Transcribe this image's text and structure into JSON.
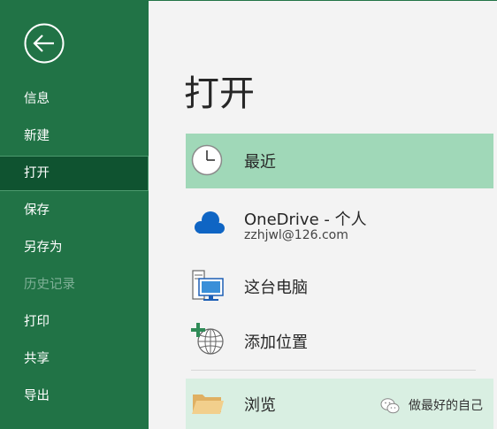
{
  "sidebar": {
    "items": [
      {
        "label": "信息"
      },
      {
        "label": "新建"
      },
      {
        "label": "打开",
        "active": true
      },
      {
        "label": "保存"
      },
      {
        "label": "另存为"
      },
      {
        "label": "历史记录",
        "disabled": true
      },
      {
        "label": "打印"
      },
      {
        "label": "共享"
      },
      {
        "label": "导出"
      }
    ]
  },
  "main": {
    "title": "打开",
    "locations": {
      "recent": {
        "label": "最近",
        "icon": "clock-icon"
      },
      "onedrive": {
        "label": "OneDrive - 个人",
        "account": "zzhjwl@126.com",
        "icon": "cloud-icon"
      },
      "pc": {
        "label": "这台电脑",
        "icon": "computer-icon"
      },
      "add": {
        "label": "添加位置",
        "icon": "add-globe-icon"
      },
      "browse": {
        "label": "浏览",
        "icon": "folder-icon"
      }
    }
  },
  "watermark": {
    "text": "做最好的自己",
    "icon": "wechat-icon"
  },
  "colors": {
    "brand_green": "#217346",
    "active_item": "#0f5330",
    "recent_highlight": "#a0d8b8",
    "browse_highlight": "#d9efe2",
    "cloud_blue": "#0f65c4"
  }
}
